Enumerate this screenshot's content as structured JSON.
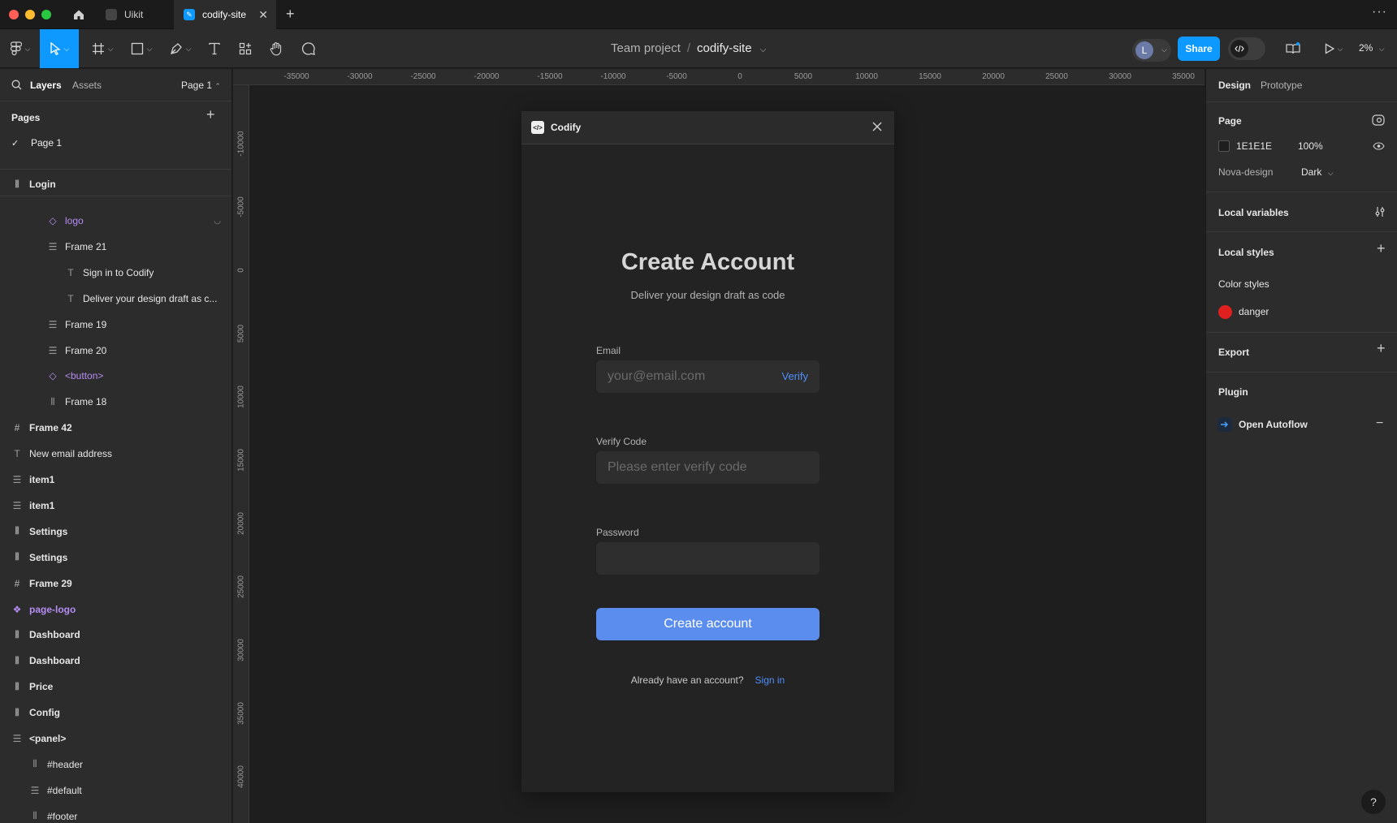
{
  "tabs": [
    {
      "label": "Uikit"
    },
    {
      "label": "codify-site"
    }
  ],
  "toolbar": {
    "project": "Team project",
    "separator": "/",
    "file": "codify-site",
    "avatar_initial": "L",
    "share": "Share",
    "zoom": "2%"
  },
  "left_panel": {
    "tab_layers": "Layers",
    "tab_assets": "Assets",
    "page_selector": "Page 1",
    "pages_title": "Pages",
    "current_page": "Page 1",
    "layers": [
      {
        "label": "Login",
        "icon": "auto-layout-icon",
        "indent": 0,
        "bold": true
      },
      {
        "label": "logo",
        "icon": "component-instance-icon",
        "indent": 2,
        "component": true,
        "hidden": true
      },
      {
        "label": "Frame 21",
        "icon": "auto-layout-vertical-icon",
        "indent": 2
      },
      {
        "label": "Sign in to Codify",
        "icon": "text-icon",
        "indent": 3
      },
      {
        "label": "Deliver your design draft as c...",
        "icon": "text-icon",
        "indent": 3
      },
      {
        "label": "Frame 19",
        "icon": "auto-layout-vertical-icon",
        "indent": 2
      },
      {
        "label": "Frame 20",
        "icon": "auto-layout-vertical-icon",
        "indent": 2
      },
      {
        "label": "<button>",
        "icon": "component-instance-icon",
        "indent": 2,
        "component": true
      },
      {
        "label": "Frame 18",
        "icon": "auto-layout-icon",
        "indent": 2
      },
      {
        "label": "Frame 42",
        "icon": "frame-icon",
        "indent": 0,
        "bold": true
      },
      {
        "label": "New email address",
        "icon": "text-icon",
        "indent": 0
      },
      {
        "label": "item1",
        "icon": "auto-layout-vertical-icon",
        "indent": 0,
        "bold": true
      },
      {
        "label": "item1",
        "icon": "auto-layout-vertical-icon",
        "indent": 0,
        "bold": true
      },
      {
        "label": "Settings",
        "icon": "auto-layout-icon",
        "indent": 0,
        "bold": true
      },
      {
        "label": "Settings",
        "icon": "auto-layout-icon",
        "indent": 0,
        "bold": true
      },
      {
        "label": "Frame 29",
        "icon": "frame-icon",
        "indent": 0,
        "bold": true
      },
      {
        "label": "page-logo",
        "icon": "component-icon",
        "indent": 0,
        "bold": true,
        "component": true
      },
      {
        "label": "Dashboard",
        "icon": "auto-layout-icon",
        "indent": 0,
        "bold": true
      },
      {
        "label": "Dashboard",
        "icon": "auto-layout-icon",
        "indent": 0,
        "bold": true
      },
      {
        "label": "Price",
        "icon": "auto-layout-icon",
        "indent": 0,
        "bold": true
      },
      {
        "label": "Config",
        "icon": "auto-layout-icon",
        "indent": 0,
        "bold": true
      },
      {
        "label": "<panel>",
        "icon": "auto-layout-vertical-icon",
        "indent": 0,
        "bold": true
      },
      {
        "label": "#header",
        "icon": "auto-layout-icon",
        "indent": 1
      },
      {
        "label": "#default",
        "icon": "auto-layout-vertical-icon",
        "indent": 1
      },
      {
        "label": "#footer",
        "icon": "auto-layout-icon",
        "indent": 1
      }
    ]
  },
  "rulers": {
    "top": [
      "-35000",
      "-30000",
      "-25000",
      "-20000",
      "-15000",
      "-10000",
      "-5000",
      "0",
      "5000",
      "10000",
      "15000",
      "20000",
      "25000",
      "30000",
      "35000"
    ],
    "left": [
      "-10000",
      "-5000",
      "0",
      "5000",
      "10000",
      "15000",
      "20000",
      "25000",
      "30000",
      "35000",
      "40000"
    ]
  },
  "frame": {
    "title": "Codify",
    "heading": "Create Account",
    "subheading": "Deliver your design draft as code",
    "email_label": "Email",
    "email_placeholder": "your@email.com",
    "verify_link": "Verify",
    "code_label": "Verify Code",
    "code_placeholder": "Please enter verify code",
    "password_label": "Password",
    "password_value": "",
    "submit": "Create account",
    "already": "Already have an account?",
    "signin": "Sign in"
  },
  "right_panel": {
    "tab_design": "Design",
    "tab_prototype": "Prototype",
    "page_section": "Page",
    "page_color": "1E1E1E",
    "page_opacity": "100%",
    "theme_collection": "Nova-design",
    "theme_mode": "Dark",
    "local_variables": "Local variables",
    "local_styles": "Local styles",
    "color_styles": "Color styles",
    "style_danger": "danger",
    "export": "Export",
    "plugin": "Plugin",
    "plugin_name": "Open Autoflow"
  },
  "colors": {
    "accent": "#0d99ff",
    "button": "#5b8def",
    "link": "#4f8ef7",
    "danger": "#e0201e",
    "component": "#b48cf2"
  },
  "help": "?"
}
